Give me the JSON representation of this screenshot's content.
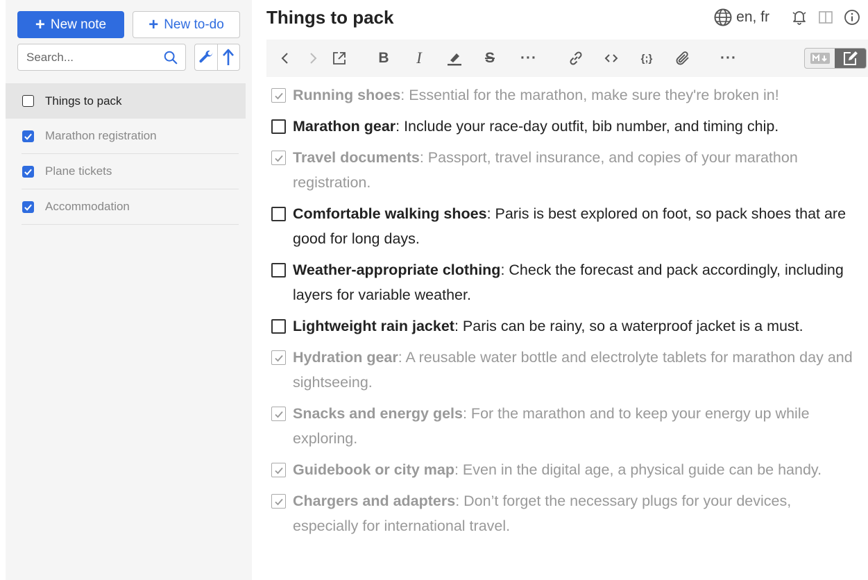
{
  "sidebar": {
    "new_note_label": "New note",
    "new_todo_label": "New to-do",
    "search_placeholder": "Search...",
    "notes": [
      {
        "title": "Things to pack",
        "checked": false,
        "selected": true
      },
      {
        "title": "Marathon registration",
        "checked": true,
        "selected": false
      },
      {
        "title": "Plane tickets",
        "checked": true,
        "selected": false
      },
      {
        "title": "Accommodation",
        "checked": true,
        "selected": false
      }
    ]
  },
  "editor": {
    "title": "Things to pack",
    "spellcheck_languages": "en, fr",
    "tasks": [
      {
        "name": "Running shoes",
        "text": ": Essential for the marathon, make sure they're broken in!",
        "done": true
      },
      {
        "name": "Marathon gear",
        "text": ": Include your race-day outfit, bib number, and timing chip.",
        "done": false
      },
      {
        "name": "Travel documents",
        "text": ": Passport, travel insurance, and copies of your marathon registration.",
        "done": true
      },
      {
        "name": "Comfortable walking shoes",
        "text": ": Paris is best explored on foot, so pack shoes that are good for long days.",
        "done": false
      },
      {
        "name": "Weather-appropriate clothing",
        "text": ": Check the forecast and pack accordingly, including layers for variable weather.",
        "done": false
      },
      {
        "name": "Lightweight rain jacket",
        "text": ": Paris can be rainy, so a waterproof jacket is a must.",
        "done": false
      },
      {
        "name": "Hydration gear",
        "text": ": A reusable water bottle and electrolyte tablets for marathon day and sightseeing.",
        "done": true
      },
      {
        "name": "Snacks and energy gels",
        "text": ": For the marathon and to keep your energy up while exploring.",
        "done": true
      },
      {
        "name": "Guidebook or city map",
        "text": ": Even in the digital age, a physical guide can be handy.",
        "done": true
      },
      {
        "name": "Chargers and adapters",
        "text": ": Don’t forget the necessary plugs for your devices, especially for international travel.",
        "done": true
      }
    ]
  },
  "toolbar": {
    "icons": [
      "back-icon",
      "forward-icon",
      "external-edit-icon",
      "bold-icon",
      "italic-icon",
      "highlight-icon",
      "strikethrough-icon",
      "more-icon",
      "link-icon",
      "code-icon",
      "code-block-icon",
      "attach-icon",
      "more-icon"
    ]
  },
  "colors": {
    "accent": "#2f6cdf",
    "sidebar_bg": "#f5f5f5",
    "selected_bg": "#e5e5e5",
    "done_text": "#999999"
  }
}
